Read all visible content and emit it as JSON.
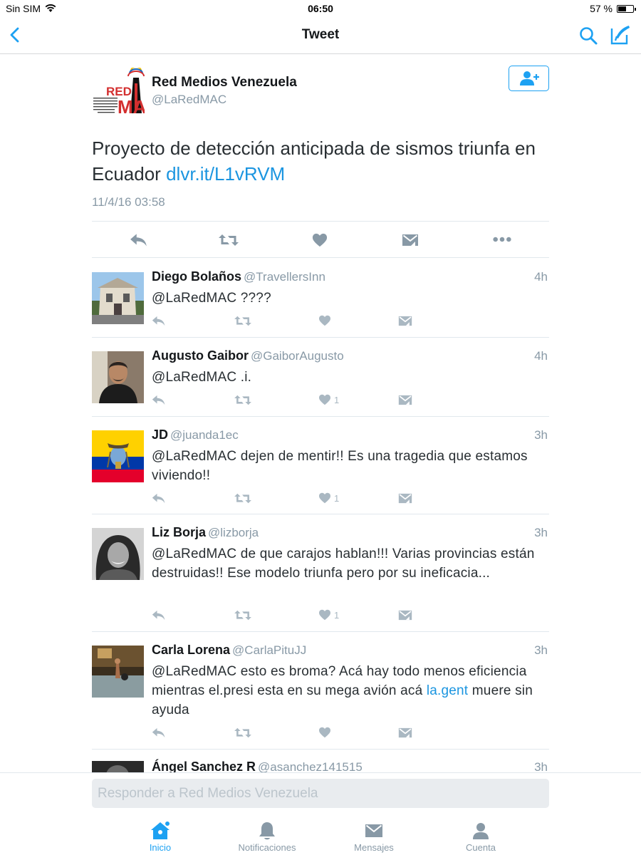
{
  "status": {
    "carrier": "Sin SIM",
    "time": "06:50",
    "battery": "57 %",
    "battery_level": 0.57
  },
  "nav": {
    "title": "Tweet"
  },
  "tweet": {
    "name": "Red Medios Venezuela",
    "handle": "@LaRedMAC",
    "logo_text": "RED",
    "logo_text2": "MA",
    "logo_sub": "DE MEDIOS ALTERNATIVOS COMUNITARIOS DEL ESTADO CARABOBO",
    "text": "Proyecto de detección anticipada de sismos triunfa en Ecuador ",
    "link": "dlvr.it/L1vRVM",
    "timestamp": "11/4/16 03:58"
  },
  "replies": [
    {
      "name": "Diego Bolaños",
      "handle": "@TravellersInn",
      "time": "4h",
      "text": "@LaRedMAC ????",
      "likes": ""
    },
    {
      "name": "Augusto Gaibor",
      "handle": "@GaiborAugusto",
      "time": "4h",
      "text": "@LaRedMAC .i.",
      "likes": "1"
    },
    {
      "name": "JD",
      "handle": "@juanda1ec",
      "time": "3h",
      "text": "@LaRedMAC dejen de mentir!! Es una tragedia que estamos viviendo!!",
      "likes": "1"
    },
    {
      "name": "Liz Borja",
      "handle": "@lizborja",
      "time": "3h",
      "text": "@LaRedMAC de que carajos hablan!!! Varias provincias están destruidas!! Ese modelo triunfa pero por su ineficacia...",
      "likes": "1"
    },
    {
      "name": "Carla Lorena",
      "handle": "@CarlaPituJJ",
      "time": "3h",
      "text": "@LaRedMAC esto es broma?  Acá hay todo menos eficiencia mientras el.presi esta en su mega avión acá ",
      "link": "la.gent",
      "text_after": " muere sin ayuda",
      "likes": ""
    },
    {
      "name": "Ángel Sanchez R",
      "handle": "@asanchez141515",
      "time": "3h"
    }
  ],
  "reply_box": {
    "placeholder": "Responder a Red Medios Venezuela"
  },
  "tabs": [
    {
      "label": "Inicio",
      "icon": "home-icon",
      "active": true
    },
    {
      "label": "Notificaciones",
      "icon": "bell-icon",
      "active": false
    },
    {
      "label": "Mensajes",
      "icon": "envelope-icon",
      "active": false
    },
    {
      "label": "Cuenta",
      "icon": "person-icon",
      "active": false
    }
  ],
  "colors": {
    "accent": "#1da1f2",
    "link": "#1b95e0",
    "muted": "#8899a6",
    "icon": "#aab8c2"
  }
}
